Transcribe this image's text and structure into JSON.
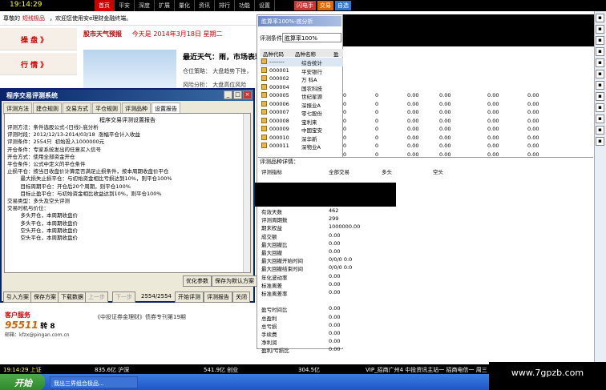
{
  "topbar": {
    "time": "19:14:29",
    "menu": [
      "首页",
      "平安",
      "深度",
      "扩展",
      "量化",
      "资讯",
      "排行",
      "功能",
      "设置"
    ],
    "btns": [
      "闪电手",
      "交易",
      "自选"
    ]
  },
  "greet": {
    "prefix": "尊敬的",
    "user": "短线极品",
    "suffix": "，欢迎您使用安e理财金融终端。"
  },
  "nav": [
    "操 盘 》",
    "行 情 》"
  ],
  "news": {
    "weather": "股市天气预报",
    "date": "今天是 2014年3月18日 星期二",
    "headline": "最近天气：雨，市场表现萧",
    "line1": "仓位策略： 大盘趋势下挫，",
    "line2": "风险分析： 大盘高位风险"
  },
  "dialog": {
    "title": "程序交易评测系统",
    "tabs": [
      "评测方法",
      "建仓规则",
      "交易方式",
      "平仓规则",
      "评测品种",
      "设置报告"
    ],
    "heading": "程序交易评测设置报告",
    "lines": [
      "评测方法：条件选股公式-(日线)-底分析",
      "评测时段：2012/12/13-2014/03/18  涨幅平仓计入收益",
      "评测条件：2554只  初始投入1000000元",
      "开仓条件：专家系统发出的任意买入信号",
      "开仓方式：使用全部资金开仓",
      "平仓条件：公式中定义的平仓条件",
      "止损平仓：按当日收盘价计算是否满足止损条件，按本周期收盘价平仓",
      "        最大损失止损平仓：与初始资金相比亏损达到10%，则平仓100%",
      "        目标周期平仓：开仓后20个周期，则平仓100%",
      "        目标止盈平仓：与初始资金相比收益达到10%，则平仓100%",
      "",
      "交易类型：多头及空头评测",
      "交易时机与价位：",
      "        多头开仓，本周期收盘价",
      "        多头平仓，本周期收盘价",
      "        空头开仓，本周期收盘价",
      "        空头平仓，本周期收盘价"
    ],
    "btn_opt": "优化参数",
    "btn_default": "保存为默认方案",
    "bottom": [
      "引入方案",
      "保存方案",
      "下载数据",
      "上一步",
      "下一步"
    ],
    "count": "2554/2554",
    "start": "开始评测",
    "report": "评测报告",
    "close": "关闭"
  },
  "cs": {
    "title": "客户服务",
    "phone": "95511",
    "suffix": "转 8",
    "mail": "邮箱：kfzx@pingan.com.cn"
  },
  "promo": "《中投证券金理财》债券专刊第19期",
  "rpanel": {
    "title": "胜算率100%-底分析",
    "cond_label": "评测条件",
    "cond_value": "胜算率100%",
    "head": [
      "品种代码",
      "品种名称",
      "盈利"
    ],
    "rows": [
      [
        "--------",
        "综合统计"
      ],
      [
        "000001",
        "平安银行"
      ],
      [
        "000002",
        "万 科A"
      ],
      [
        "000004",
        "国农科技"
      ],
      [
        "000005",
        "世纪星源"
      ],
      [
        "000006",
        "深振业A"
      ],
      [
        "000007",
        "零七股份"
      ],
      [
        "000008",
        "宝利来"
      ],
      [
        "000009",
        "中国宝安"
      ],
      [
        "000010",
        "深华新"
      ],
      [
        "000011",
        "深物业A"
      ]
    ]
  },
  "table_rows": [
    [
      "0",
      "0",
      "0.00",
      "0.00",
      "0.00",
      "0.00"
    ],
    [
      "0",
      "0",
      "0.00",
      "0.00",
      "0.00",
      "0.00"
    ],
    [
      "0",
      "0",
      "0.00",
      "0.00",
      "0.00",
      "0.00"
    ],
    [
      "0",
      "0",
      "0.00",
      "0.00",
      "0.00",
      "0.00"
    ],
    [
      "0",
      "0",
      "0.00",
      "0.00",
      "0.00",
      "0.00"
    ],
    [
      "0",
      "0",
      "0.00",
      "0.00",
      "0.00",
      "0.00"
    ],
    [
      "0",
      "0",
      "0.00",
      "0.00",
      "0.00",
      "0.00"
    ],
    [
      "0",
      "0",
      "0.00",
      "0.00",
      "0.00",
      "0.00"
    ],
    [
      "0",
      "0",
      "0.00",
      "0.00",
      "0.00",
      "0.00"
    ]
  ],
  "detail": {
    "title": "评测品种详情：",
    "head": [
      "评测指标",
      "全部交易",
      "多头",
      "空头"
    ],
    "items": [
      [
        "有效天数",
        "462"
      ],
      [
        "评测周期数",
        "299"
      ],
      [
        "期末权益",
        "1000000.00"
      ],
      [
        "成交额",
        "0.00"
      ],
      [
        "最大回撤比",
        "0.00"
      ],
      [
        "最大回撤",
        "0.00"
      ],
      [
        "最大回撤开始时间",
        "0/0/0 0:0"
      ],
      [
        "最大回撤结束时间",
        "0/0/0 0:0"
      ],
      [
        "年化波动率",
        "0.00"
      ],
      [
        "标准离差",
        "0.00"
      ],
      [
        "标准离差率",
        "0.00"
      ],
      [
        "",
        ""
      ],
      [
        "盈亏时间比",
        "0.00"
      ],
      [
        "总盈利",
        "0.00"
      ],
      [
        "总亏损",
        "0.00"
      ],
      [
        "手续费",
        "0.00"
      ],
      [
        "净利润",
        "0.00"
      ],
      [
        "盈利/亏损比",
        "0.00"
      ]
    ]
  },
  "ticker": {
    "t1": "19:14:29 上证",
    "t2": "835.6亿 沪深",
    "t3": "541.9亿 创业",
    "t4": "304.5亿",
    "t5": "VIP_招商广州4 中投资讯主站一 招商电信一 周三"
  },
  "taskbar": {
    "start": "开始",
    "task": "我出三界组合极品..."
  },
  "watermark": "www.7gpzb.com"
}
